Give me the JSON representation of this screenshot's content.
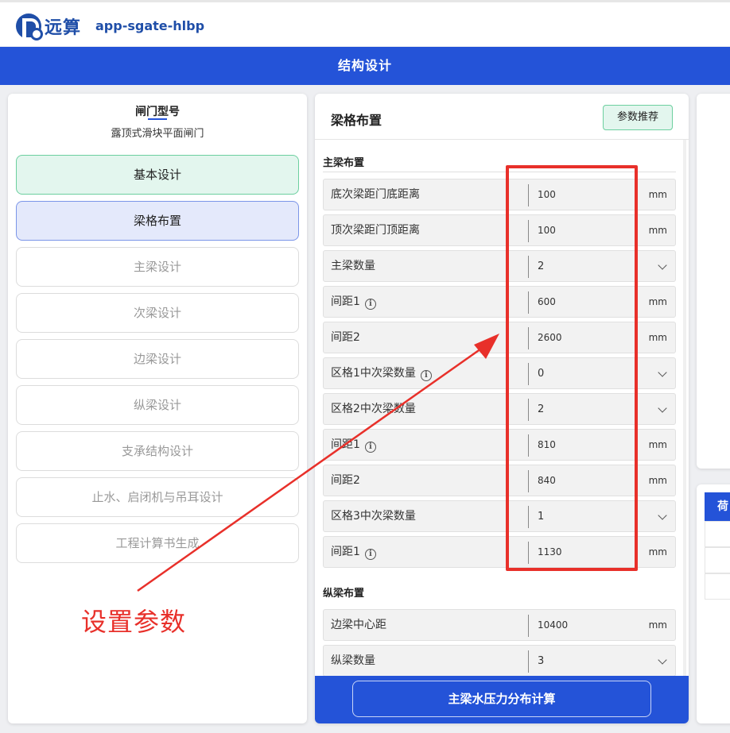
{
  "header": {
    "logo_text": "远算",
    "app_name": "app-sgate-hlbp"
  },
  "title_bar": "结构设计",
  "sidebar": {
    "gate_type_label": "闸门型号",
    "gate_type_value": "露顶式滑块平面闸门",
    "steps": [
      {
        "label": "基本设计",
        "state": "done"
      },
      {
        "label": "梁格布置",
        "state": "active"
      },
      {
        "label": "主梁设计",
        "state": "disabled"
      },
      {
        "label": "次梁设计",
        "state": "disabled"
      },
      {
        "label": "边梁设计",
        "state": "disabled"
      },
      {
        "label": "纵梁设计",
        "state": "disabled"
      },
      {
        "label": "支承结构设计",
        "state": "disabled"
      },
      {
        "label": "止水、启闭机与吊耳设计",
        "state": "disabled"
      },
      {
        "label": "工程计算书生成",
        "state": "disabled"
      }
    ]
  },
  "main": {
    "title": "梁格布置",
    "recommend_button": "参数推荐",
    "main_beam_section": "主梁布置",
    "rows": [
      {
        "label": "底次梁距门底距离",
        "value": "100",
        "unit": "mm",
        "type": "input",
        "info": false
      },
      {
        "label": "顶次梁距门顶距离",
        "value": "100",
        "unit": "mm",
        "type": "input",
        "info": false
      },
      {
        "label": "主梁数量",
        "value": "2",
        "unit": "",
        "type": "select",
        "info": false
      },
      {
        "label": "间距1",
        "value": "600",
        "unit": "mm",
        "type": "input",
        "info": true
      },
      {
        "label": "间距2",
        "value": "2600",
        "unit": "mm",
        "type": "input",
        "info": false
      },
      {
        "label": "区格1中次梁数量",
        "value": "0",
        "unit": "",
        "type": "select",
        "info": true
      },
      {
        "label": "区格2中次梁数量",
        "value": "2",
        "unit": "",
        "type": "select",
        "info": false
      },
      {
        "label": "间距1",
        "value": "810",
        "unit": "mm",
        "type": "input",
        "info": true
      },
      {
        "label": "间距2",
        "value": "840",
        "unit": "mm",
        "type": "input",
        "info": false
      },
      {
        "label": "区格3中次梁数量",
        "value": "1",
        "unit": "",
        "type": "select",
        "info": false
      },
      {
        "label": "间距1",
        "value": "1130",
        "unit": "mm",
        "type": "input",
        "info": true
      }
    ],
    "longitudinal_section": "纵梁布置",
    "long_rows": [
      {
        "label": "边梁中心距",
        "value": "10400",
        "unit": "mm",
        "type": "input",
        "info": false
      },
      {
        "label": "纵梁数量",
        "value": "3",
        "unit": "",
        "type": "select",
        "info": false
      }
    ],
    "calc_button": "主梁水压力分布计算"
  },
  "right_panel": {
    "tab_label": "荷"
  },
  "annotation": {
    "text": "设置参数",
    "color": "#e8302a"
  },
  "colors": {
    "brand": "#2453d8",
    "done_bg": "#e3f6ee",
    "active_bg": "#e4e9fb"
  }
}
